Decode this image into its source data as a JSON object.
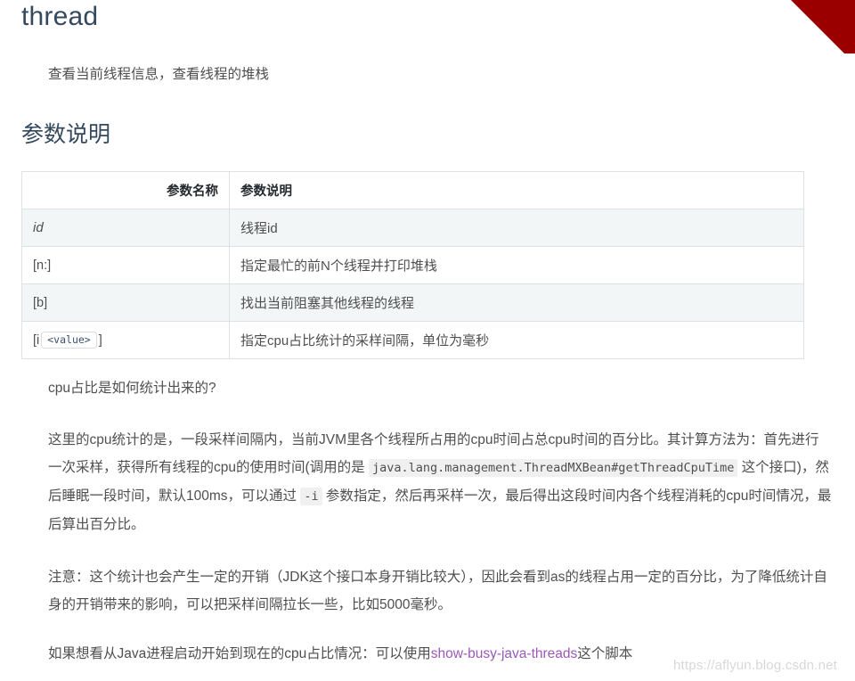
{
  "document": {
    "title": "thread",
    "lead": "查看当前线程信息，查看线程的堆栈",
    "section_title": "参数说明"
  },
  "table": {
    "headers": [
      "参数名称",
      "参数说明"
    ],
    "rows": [
      {
        "name": "id",
        "name_style": "italic",
        "desc": "线程id"
      },
      {
        "name": "[n:]",
        "name_style": "plain",
        "desc": "指定最忙的前N个线程并打印堆栈"
      },
      {
        "name": "[b]",
        "name_style": "plain",
        "desc": "找出当前阻塞其他线程的线程"
      },
      {
        "name_prefix": "[i",
        "name_chip": "<value>",
        "name_suffix": "]",
        "name_style": "chip",
        "desc": "指定cpu占比统计的采样间隔，单位为毫秒"
      }
    ]
  },
  "paragraphs": {
    "question": "cpu占比是如何统计出来的?",
    "main_part1": "这里的cpu统计的是，一段采样间隔内，当前JVM里各个线程所占用的cpu时间占总cpu时间的百分比。其计算方法为：首先进行一次采样，获得所有线程的cpu的使用时间(调用的是 ",
    "main_code1": "java.lang.management.ThreadMXBean#getThreadCpuTime",
    "main_part2": " 这个接口)，然后睡眠一段时间，默认100ms，可以通过 ",
    "main_code2": "-i",
    "main_part3": " 参数指定，然后再采样一次，最后得出这段时间内各个线程消耗的cpu时间情况，最后算出百分比。",
    "note": "注意：这个统计也会产生一定的开销（JDK这个接口本身开销比较大），因此会看到as的线程占用一定的百分比，为了降低统计自身的开销带来的影响，可以把采样间隔拉长一些，比如5000毫秒。",
    "last_part1": "如果想看从Java进程启动开始到现在的cpu占比情况：可以使用",
    "last_link": "show-busy-java-threads",
    "last_part2": "这个脚本"
  },
  "watermark": {
    "text": "https://aflyun.blog.csdn.net"
  },
  "decoration": {
    "ribbon_color": "#9b0000",
    "link_color": "#9b59b6",
    "heading_color": "#34495e"
  }
}
